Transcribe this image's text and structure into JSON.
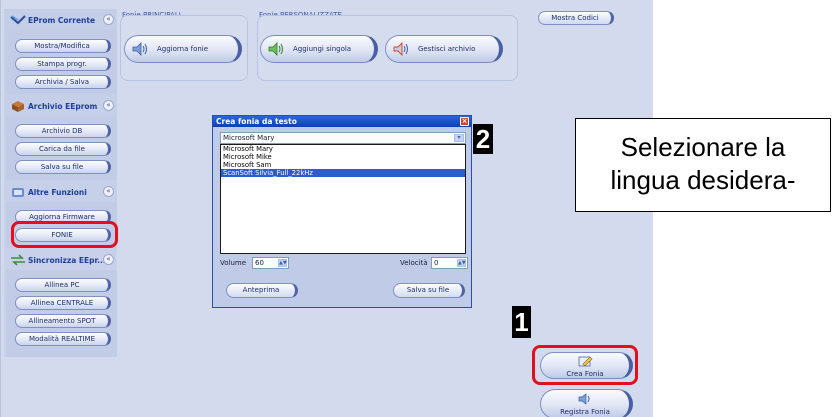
{
  "sidebar": {
    "sections": [
      {
        "title": "EProm Corrente",
        "buttons": [
          "Mostra/Modifica",
          "Stampa progr.",
          "Archivia / Salva"
        ]
      },
      {
        "title": "Archivio EEprom",
        "buttons": [
          "Archivio DB",
          "Carica da file",
          "Salva su file"
        ]
      },
      {
        "title": "Altre Funzioni",
        "buttons": [
          "Aggiorna Firmware",
          "FONIE"
        ]
      },
      {
        "title": "Sincronizza EEpr...",
        "buttons": [
          "Allinea PC",
          "Allinea CENTRALE",
          "Allineamento SPOT",
          "Modalità REALTIME"
        ]
      }
    ],
    "collapse_glyph": "«"
  },
  "groups": {
    "principali": {
      "label": "Fonie PRINCIPALI",
      "button": "Aggiorna fonie"
    },
    "personalizzate": {
      "label": "Fonie PERSONALIZZATE",
      "button_single": "Aggiungi singola",
      "button_archive": "Gestisci archivio"
    }
  },
  "toolbar": {
    "mostra_codici": "Mostra Codici"
  },
  "dialog": {
    "title": "Crea fonia da testo",
    "close_glyph": "×",
    "voice_selected": "Microsoft Mary",
    "voices": [
      "Microsoft Mary",
      "Microsoft Mike",
      "Microsoft Sam",
      "ScanSoft Silvia_Full_22kHz"
    ],
    "highlighted_voice_index": 3,
    "volume_label": "Volume",
    "volume_value": "60",
    "speed_label": "Velocità",
    "speed_value": "0",
    "preview_button": "Anteprima",
    "save_button": "Salva su file"
  },
  "actions": {
    "crea_fonia": "Crea Fonia",
    "registra_fonia": "Registra Fonia"
  },
  "annotations": {
    "step1": "1",
    "step2": "2",
    "callout_line1": "Selezionare la",
    "callout_line2": "lingua desidera-",
    "highlight_color": "#e3101b"
  },
  "colors": {
    "app_background": "#d3daed",
    "sidebar_title": "#1d3f9a",
    "dialog_titlebar": "#0b3fb8",
    "selection": "#2f5bd0"
  }
}
